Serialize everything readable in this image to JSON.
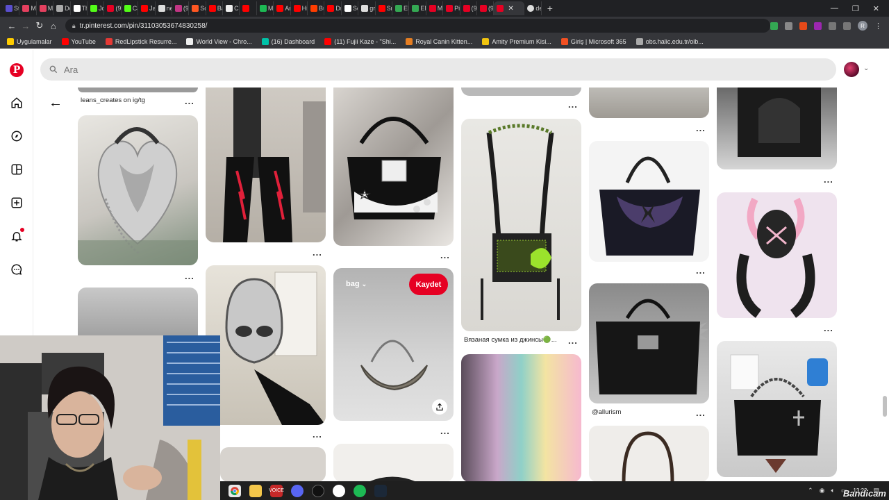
{
  "browser": {
    "tabs": [
      {
        "label": "St",
        "color": "#5a4fcf"
      },
      {
        "label": "M",
        "color": "#e4405f"
      },
      {
        "label": "M",
        "color": "#e4405f"
      },
      {
        "label": "Do",
        "color": "#aaaaaa"
      },
      {
        "label": "Th",
        "color": "#ffffff"
      },
      {
        "label": "Jo",
        "color": "#53fc18"
      },
      {
        "label": "(9",
        "color": "#e60023"
      },
      {
        "label": "Ca",
        "color": "#53fc18"
      },
      {
        "label": "Ja",
        "color": "#ff0000"
      },
      {
        "label": "ne",
        "color": "#dddddd"
      },
      {
        "label": "(9",
        "color": "#c13584"
      },
      {
        "label": "Sc",
        "color": "#ff5722"
      },
      {
        "label": "Ba",
        "color": "#ff0000"
      },
      {
        "label": "Ch",
        "color": "#eeeeee"
      },
      {
        "label": "",
        "color": "#ff0000"
      },
      {
        "label": "M",
        "color": "#1db954"
      },
      {
        "label": "An",
        "color": "#ff0000"
      },
      {
        "label": "Hi",
        "color": "#ff0000"
      },
      {
        "label": "Bü",
        "color": "#ff3d00"
      },
      {
        "label": "Dr",
        "color": "#ff0000"
      },
      {
        "label": "Sc",
        "color": "#ffffff"
      },
      {
        "label": "gr",
        "color": "#dddddd"
      },
      {
        "label": "Sn",
        "color": "#ff0000"
      },
      {
        "label": "EN",
        "color": "#34a853"
      },
      {
        "label": "EN",
        "color": "#34a853"
      },
      {
        "label": "M",
        "color": "#e60023"
      },
      {
        "label": "Pir",
        "color": "#e60023"
      },
      {
        "label": "(9",
        "color": "#e60023"
      },
      {
        "label": "(9",
        "color": "#e60023"
      }
    ],
    "active_tab": {
      "label": "",
      "color": "#e60023"
    },
    "last_tab": {
      "label": "de",
      "color": "#dddddd"
    },
    "new_tab": "+",
    "url": "tr.pinterest.com/pin/311030536748302​58/",
    "bookmarks": [
      {
        "label": "Uygulamalar",
        "color": "#ffcc00"
      },
      {
        "label": "YouTube",
        "color": "#ff0000"
      },
      {
        "label": "RedLipstick Resurre...",
        "color": "#e53935"
      },
      {
        "label": "World View - Chro...",
        "color": "#eeeeee"
      },
      {
        "label": "(16) Dashboard",
        "color": "#00c2a8"
      },
      {
        "label": "(11) Fujii Kaze - \"Shi...",
        "color": "#ff0000"
      },
      {
        "label": "Royal Canin Kitten...",
        "color": "#e67e22"
      },
      {
        "label": "Amity Premium Kisi...",
        "color": "#f1c40f"
      },
      {
        "label": "Giriş | Microsoft 365",
        "color": "#f25022"
      },
      {
        "label": "obs.halic.edu.tr/oib...",
        "color": "#aaaaaa"
      }
    ]
  },
  "pinterest": {
    "search_placeholder": "Ara",
    "save_label": "Kaydet",
    "board_label": "bag",
    "captions": {
      "pin1": "leans_creates on ig/tg",
      "pin2": "Вязаная сумка из джинсы🟢...",
      "pin3": "@allurism"
    },
    "more": "..."
  },
  "taskbar": {
    "time": "13:22",
    "watermark": "Bandicam"
  }
}
